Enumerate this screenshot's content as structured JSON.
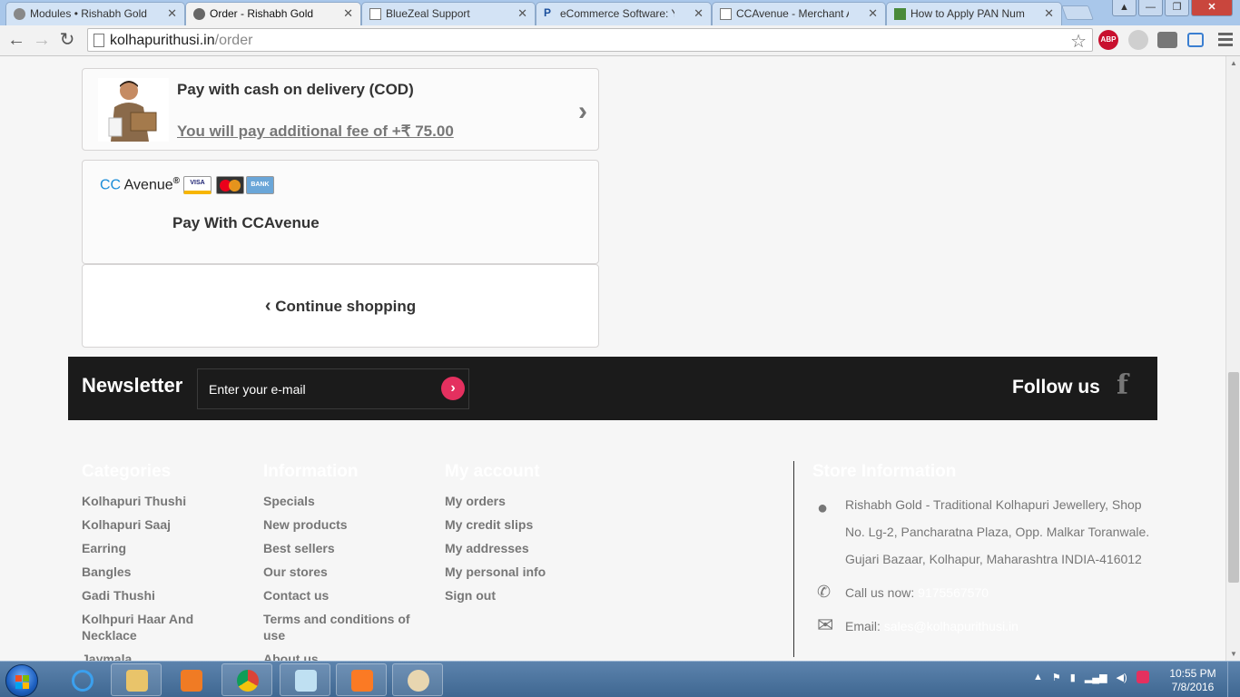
{
  "browser": {
    "tabs": [
      {
        "label": "Modules • Rishabh Gold",
        "active": false
      },
      {
        "label": "Order - Rishabh Gold",
        "active": true
      },
      {
        "label": "BlueZeal Support",
        "active": false
      },
      {
        "label": "eCommerce Software: Yo",
        "active": false
      },
      {
        "label": "CCAvenue - Merchant Acc",
        "active": false
      },
      {
        "label": "How to Apply PAN Numb",
        "active": false
      }
    ],
    "url_host": "kolhapurithusi.in",
    "url_path": "/order",
    "ext_abp": "ABP"
  },
  "payment": {
    "cod_title": "Pay with cash on delivery (COD)",
    "cod_fee": "You will pay additional fee of +₹ 75.00",
    "cca_logo_cc": "CC",
    "cca_logo_avenue": "Avenue",
    "cca_logo_reg": "®",
    "card_visa": "VISA",
    "card_bank": "BANK",
    "cca_title": "Pay With CCAvenue",
    "continue_label": "Continue shopping"
  },
  "newsletter": {
    "title": "Newsletter",
    "placeholder": "Enter your e-mail",
    "follow_label": "Follow us"
  },
  "footer": {
    "categories": {
      "heading": "Categories",
      "items": [
        "Kolhapuri Thushi",
        "Kolhapuri Saaj",
        "Earring",
        "Bangles",
        "Gadi Thushi",
        "Kolhpuri Haar And Necklace",
        "Jaymala"
      ]
    },
    "information": {
      "heading": "Information",
      "items": [
        "Specials",
        "New products",
        "Best sellers",
        "Our stores",
        "Contact us",
        "Terms and conditions of use",
        "About us"
      ]
    },
    "account": {
      "heading": "My account",
      "items": [
        "My orders",
        "My credit slips",
        "My addresses",
        "My personal info",
        "Sign out"
      ]
    },
    "store": {
      "heading": "Store Information",
      "address": "Rishabh Gold - Traditional Kolhapuri Jewellery, Shop No. Lg-2, Pancharatna Plaza, Opp. Malkar Toranwale. Gujari Bazaar, Kolhapur, Maharashtra INDIA-416012",
      "call_label": "Call us now:",
      "phone": "9175567570",
      "email_label": "Email:",
      "email": "sales@kolhapurithusi.in"
    }
  },
  "taskbar": {
    "time": "10:55 PM",
    "date": "7/8/2016"
  }
}
